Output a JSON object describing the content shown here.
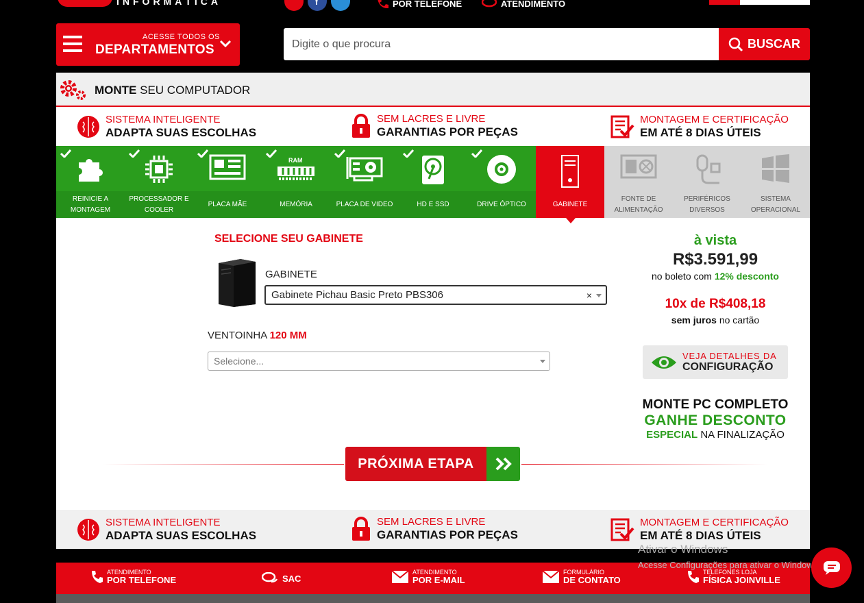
{
  "header": {
    "logo_text": "INFORMÁTICA",
    "phone_link": {
      "label": "POR TELEFONE"
    },
    "support_link": {
      "label": "ATENDIMENTO"
    },
    "departments": {
      "small": "ACESSE TODOS OS",
      "big": "DEPARTAMENTOS"
    },
    "search": {
      "placeholder": "Digite o que procura",
      "button": "BUSCAR"
    }
  },
  "page_title": {
    "bold": "MONTE",
    "rest": "SEU COMPUTADOR"
  },
  "features": [
    {
      "line1": "SISTEMA INTELIGENTE",
      "line2": "ADAPTA SUAS ESCOLHAS",
      "icon": "brain-icon"
    },
    {
      "line1": "SEM LACRES E LIVRE",
      "line2": "GARANTIAS POR PEÇAS",
      "icon": "lock-icon"
    },
    {
      "line1": "MONTAGEM E CERTIFICAÇÃO",
      "line2": "EM ATÉ 8 DIAS ÚTEIS",
      "icon": "checklist-icon"
    }
  ],
  "steps": [
    {
      "label": "REINICIE A MONTAGEM",
      "state": "done",
      "icon": "puzzle-icon"
    },
    {
      "label": "PROCESSADOR E COOLER",
      "state": "done",
      "icon": "cpu-icon"
    },
    {
      "label": "PLACA MÃE",
      "state": "done",
      "icon": "motherboard-icon"
    },
    {
      "label": "MEMÓRIA",
      "state": "done",
      "icon": "ram-icon",
      "chip_text": "RAM"
    },
    {
      "label": "PLACA DE VIDEO",
      "state": "done",
      "icon": "gpu-icon"
    },
    {
      "label": "HD E SSD",
      "state": "done",
      "icon": "hdd-icon"
    },
    {
      "label": "DRIVE ÓPTICO",
      "state": "done",
      "icon": "disc-icon"
    },
    {
      "label": "GABINETE",
      "state": "current",
      "icon": "case-icon"
    },
    {
      "label": "FONTE DE ALIMENTAÇÃO",
      "state": "todo",
      "icon": "psu-icon"
    },
    {
      "label": "PERIFÉRICOS DIVERSOS",
      "state": "todo",
      "icon": "peripherals-icon"
    },
    {
      "label": "SISTEMA OPERACIONAL",
      "state": "todo",
      "icon": "windows-icon"
    }
  ],
  "selection": {
    "title": "SELECIONE SEU GABINETE",
    "case_label": "GABINETE",
    "case_value": "Gabinete Pichau Basic Preto PBS306",
    "clear_symbol": "×",
    "fan_label": "VENTOINHA",
    "fan_size": "120 MM",
    "fan_placeholder": "Selecione..."
  },
  "pricing": {
    "cash_label": "à vista",
    "cash_price": "R$3.591,99",
    "boleto_text": "no boleto com",
    "discount": "12% desconto",
    "installments": "10x de R$408,18",
    "no_interest": "sem juros",
    "card_text": "no cartão",
    "details_line1": "VEJA DETALHES DA",
    "details_line2": "CONFIGURAÇÃO"
  },
  "promo": {
    "line1": "MONTE PC COMPLETO",
    "line2": "GANHE DESCONTO",
    "line3_green": "ESPECIAL",
    "line3_rest": "NA FINALIZAÇÃO"
  },
  "next_button": {
    "label": "PRÓXIMA ETAPA"
  },
  "footer_links": [
    {
      "small": "ATENDIMENTO",
      "big": "POR TELEFONE",
      "icon": "phone-icon"
    },
    {
      "small": "",
      "big": "SAC",
      "icon": "chat-bubbles-icon"
    },
    {
      "small": "ATENDIMENTO",
      "big": "POR E-MAIL",
      "icon": "mail-icon"
    },
    {
      "small": "FORMULÁRIO",
      "big": "DE CONTATO",
      "icon": "mail-icon"
    },
    {
      "small": "TELEFONES LOJA",
      "big": "FÍSICA JOINVILLE",
      "icon": "phone-icon"
    }
  ],
  "watermark": {
    "line1": "Ativar o Windows",
    "line2": "Acesse Configurações para ativar o Windows."
  },
  "colors": {
    "brand_red": "#e30613",
    "done_green": "#2a9d1d",
    "pending_gray": "#d6d6d6"
  }
}
